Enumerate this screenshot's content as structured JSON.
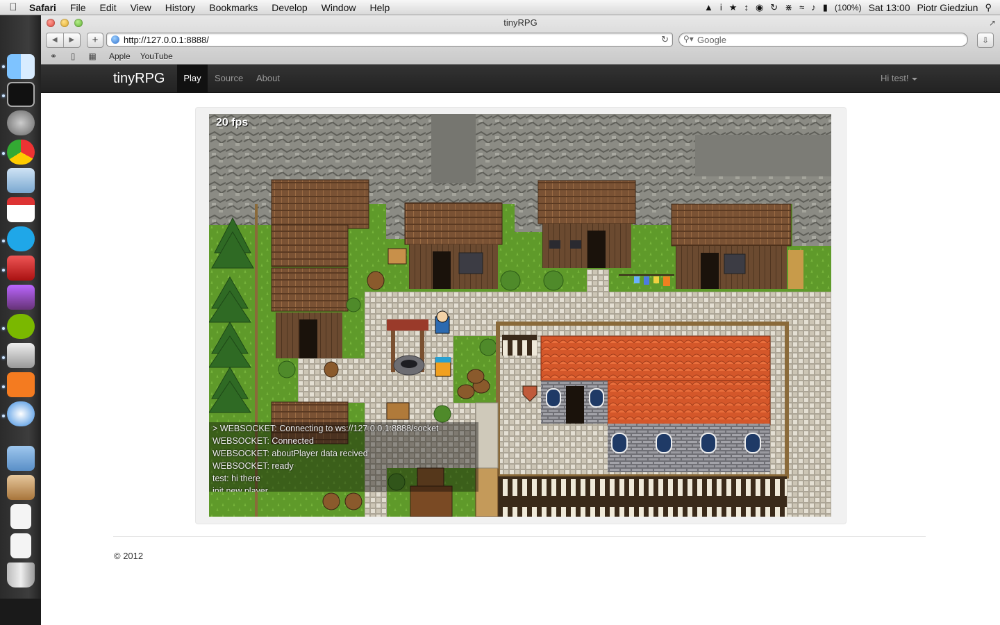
{
  "menubar": {
    "app_name": "Safari",
    "menus": [
      "File",
      "Edit",
      "View",
      "History",
      "Bookmarks",
      "Develop",
      "Window",
      "Help"
    ],
    "battery": "(100%)",
    "clock": "Sat 13:00",
    "user": "Piotr Giedziun"
  },
  "window": {
    "title": "tinyRPG",
    "url": "http://127.0.0.1:8888/",
    "search_placeholder": "Google",
    "bookmarks": [
      "Apple",
      "YouTube"
    ]
  },
  "navbar": {
    "brand": "tinyRPG",
    "links": [
      "Play",
      "Source",
      "About"
    ],
    "active": "Play",
    "user_menu": "Hi test!"
  },
  "game": {
    "fps": "20 fps",
    "log": [
      "> WEBSOCKET: Connecting to ws://127.0.0.1:8888/socket",
      "WEBSOCKET: Connected",
      "WEBSOCKET: aboutPlayer data recived",
      "WEBSOCKET: ready",
      "test: hi there",
      "init new player"
    ]
  },
  "footer": {
    "copyright": "© 2012"
  },
  "colors": {
    "navbar_bg": "#222222",
    "grass": "#5f9a2a",
    "rock": "#8d8d86",
    "roof_brown": "#7a5234",
    "roof_red": "#d4572a",
    "paving": "#d8d2c4"
  }
}
